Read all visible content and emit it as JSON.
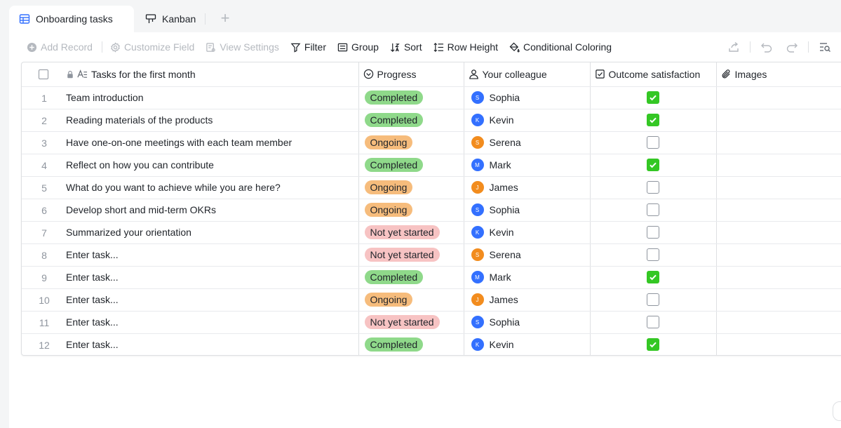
{
  "tabs": [
    {
      "label": "Onboarding tasks",
      "icon": "grid-table-icon",
      "active": true
    },
    {
      "label": "Kanban",
      "icon": "kanban-icon",
      "active": false
    }
  ],
  "toolbar": {
    "add_record": "Add Record",
    "customize_field": "Customize Field",
    "view_settings": "View Settings",
    "filter": "Filter",
    "group": "Group",
    "sort": "Sort",
    "row_height": "Row Height",
    "conditional_coloring": "Conditional Coloring"
  },
  "columns": {
    "task": "Tasks for the first month",
    "progress": "Progress",
    "colleague": "Your colleague",
    "outcome": "Outcome satisfaction",
    "images": "Images"
  },
  "colors": {
    "completed": "#8fd98a",
    "ongoing": "#f6bc7c",
    "not_yet_started": "#f7c3c3",
    "checkbox_on": "#34c724",
    "avatar_blue": "#3370ff",
    "avatar_orange": "#f28c1e"
  },
  "rows": [
    {
      "num": "1",
      "task": "Team introduction",
      "progress": "Completed",
      "status": "completed",
      "colleague": "Sophia",
      "initial": "S",
      "avatar": "blue",
      "outcome": true
    },
    {
      "num": "2",
      "task": "Reading materials of the products",
      "progress": "Completed",
      "status": "completed",
      "colleague": "Kevin",
      "initial": "K",
      "avatar": "blue",
      "outcome": true
    },
    {
      "num": "3",
      "task": "Have one-on-one meetings with each team member",
      "progress": "Ongoing",
      "status": "ongoing",
      "colleague": "Serena",
      "initial": "S",
      "avatar": "orange",
      "outcome": false
    },
    {
      "num": "4",
      "task": "Reflect on how you can contribute",
      "progress": "Completed",
      "status": "completed",
      "colleague": "Mark",
      "initial": "M",
      "avatar": "blue",
      "outcome": true
    },
    {
      "num": "5",
      "task": "What do you want to achieve while you are here?",
      "progress": "Ongoing",
      "status": "ongoing",
      "colleague": "James",
      "initial": "J",
      "avatar": "orange",
      "outcome": false
    },
    {
      "num": "6",
      "task": "Develop short and mid-term OKRs",
      "progress": "Ongoing",
      "status": "ongoing",
      "colleague": "Sophia",
      "initial": "S",
      "avatar": "blue",
      "outcome": false
    },
    {
      "num": "7",
      "task": "Summarized your orientation",
      "progress": "Not yet started",
      "status": "notyet",
      "colleague": "Kevin",
      "initial": "K",
      "avatar": "blue",
      "outcome": false
    },
    {
      "num": "8",
      "task": "Enter task...",
      "progress": "Not yet started",
      "status": "notyet",
      "colleague": "Serena",
      "initial": "S",
      "avatar": "orange",
      "outcome": false
    },
    {
      "num": "9",
      "task": "Enter task...",
      "progress": "Completed",
      "status": "completed",
      "colleague": "Mark",
      "initial": "M",
      "avatar": "blue",
      "outcome": true
    },
    {
      "num": "10",
      "task": "Enter task...",
      "progress": "Ongoing",
      "status": "ongoing",
      "colleague": "James",
      "initial": "J",
      "avatar": "orange",
      "outcome": false
    },
    {
      "num": "11",
      "task": "Enter task...",
      "progress": "Not yet started",
      "status": "notyet",
      "colleague": "Sophia",
      "initial": "S",
      "avatar": "blue",
      "outcome": false
    },
    {
      "num": "12",
      "task": "Enter task...",
      "progress": "Completed",
      "status": "completed",
      "colleague": "Kevin",
      "initial": "K",
      "avatar": "blue",
      "outcome": true
    }
  ]
}
